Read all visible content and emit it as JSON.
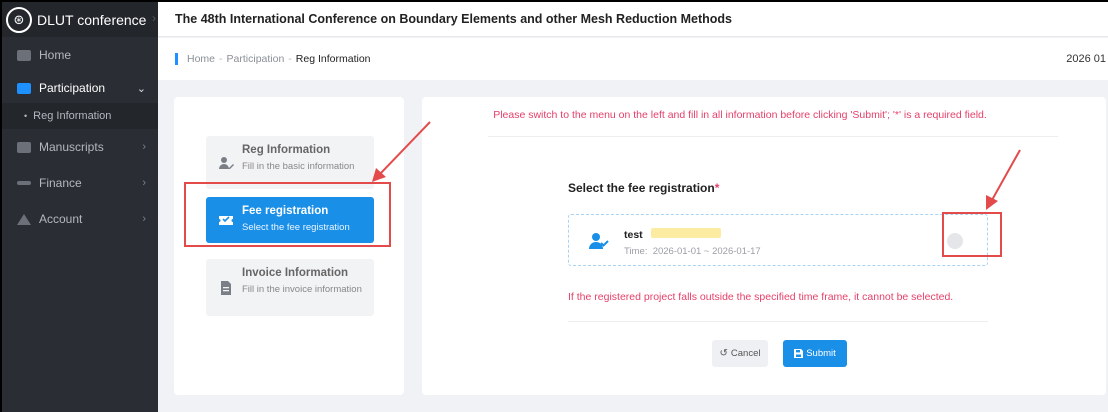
{
  "app": {
    "logo_glyph": "⊛",
    "name": "DLUT conference"
  },
  "sidebar": {
    "items": [
      {
        "label": "Home",
        "icon": "home-icon"
      },
      {
        "label": "Participation",
        "icon": "participation-icon",
        "expanded": true,
        "children": [
          {
            "label": "Reg Information"
          }
        ]
      },
      {
        "label": "Manuscripts",
        "icon": "folder-icon"
      },
      {
        "label": "Finance",
        "icon": "finance-icon"
      },
      {
        "label": "Account",
        "icon": "account-icon"
      }
    ]
  },
  "header": {
    "title": "The 48th International Conference on Boundary Elements and other Mesh Reduction Methods"
  },
  "breadcrumb": {
    "items": [
      "Home",
      "Participation",
      "Reg Information"
    ],
    "separator": "-",
    "date": "2026 01"
  },
  "steps": [
    {
      "title": "Reg Information",
      "desc": "Fill in the basic information",
      "icon": "user-edit-icon",
      "state": "inactive"
    },
    {
      "title": "Fee registration",
      "desc": "Select the fee registration",
      "icon": "ticket-icon",
      "state": "active"
    },
    {
      "title": "Invoice Information",
      "desc": "Fill in the invoice information",
      "icon": "document-icon",
      "state": "inactive"
    }
  ],
  "main": {
    "notice": "Please switch to the menu on the left and fill in all information before clicking 'Submit'; '*' is a required field.",
    "section_label": "Select the fee registration",
    "required_mark": "*",
    "fee_option": {
      "name": "test",
      "time_label": "Time:",
      "time_range": "2026-01-01 ~ 2026-01-17",
      "selected": false
    },
    "warning": "If the registered project falls outside the specified time frame, it cannot be selected.",
    "cancel_label": "Cancel",
    "submit_label": "Submit"
  },
  "colors": {
    "accent": "#1a8fe8",
    "warning": "#e6406a",
    "annotation": "#e34b4b",
    "sidebar": "#2a2d33"
  }
}
